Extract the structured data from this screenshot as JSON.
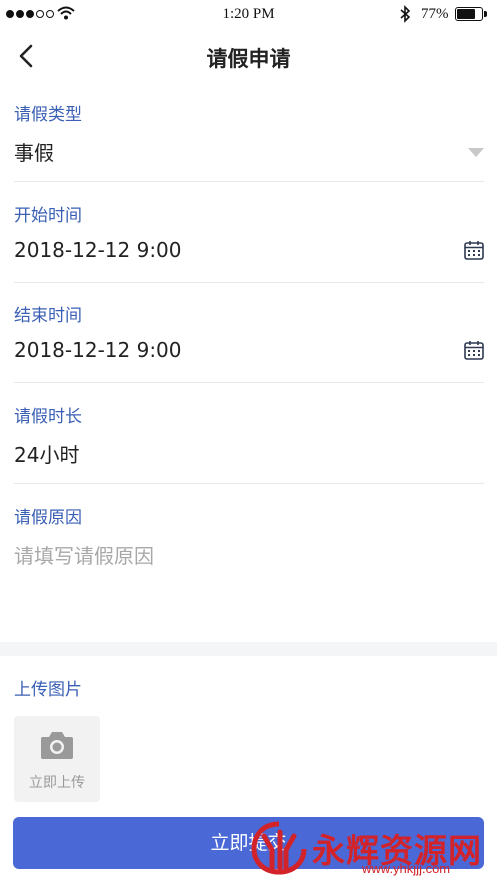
{
  "status_bar": {
    "time": "1:20 PM",
    "battery_percent": "77%",
    "battery_level": 0.77,
    "signal_bars": 3,
    "signal_total": 5
  },
  "nav": {
    "title": "请假申请",
    "back_icon": "chevron-left-icon"
  },
  "form": {
    "leave_type": {
      "label": "请假类型",
      "value": "事假"
    },
    "start_time": {
      "label": "开始时间",
      "value": "2018-12-12 9:00"
    },
    "end_time": {
      "label": "结束时间",
      "value": "2018-12-12 9:00"
    },
    "duration": {
      "label": "请假时长",
      "value": "24小时"
    },
    "reason": {
      "label": "请假原因",
      "placeholder": "请填写请假原因"
    }
  },
  "upload": {
    "label": "上传图片",
    "button_label": "立即上传"
  },
  "submit_label": "立即提交",
  "watermark": {
    "text": "永辉资源网",
    "url": "www.yhkjjj.com"
  },
  "colors": {
    "label": "#3a5fb4",
    "primary": "#4a68d6",
    "watermark": "#d2232a"
  }
}
